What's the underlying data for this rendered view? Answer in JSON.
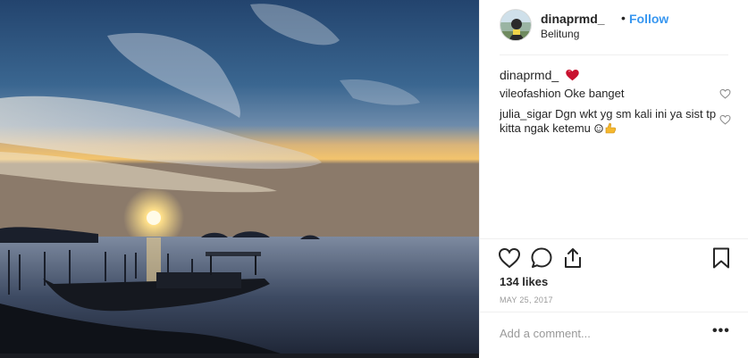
{
  "post": {
    "photo_icon": "sunset-photo",
    "author": {
      "username": "dinaprmd_",
      "separator": "•",
      "follow_label": "Follow",
      "location": "Belitung",
      "avatar_icon": "avatar-photo"
    },
    "caption": {
      "username": "dinaprmd_",
      "emoji": "heart-emoji"
    },
    "comments": [
      {
        "username": "vileofashion",
        "text": "Oke banget"
      },
      {
        "username": "julia_sigar",
        "text": "Dgn wkt yg sm kali ini ya sist tp kitta ngak ketemu"
      }
    ],
    "likes_label": "134 likes",
    "date_label": "MAY 25, 2017",
    "add_comment_placeholder": "Add a comment...",
    "more_label": "•••"
  },
  "colors": {
    "accent": "#3897f0",
    "text": "#262626",
    "muted": "#999999",
    "heart": "#ed4956"
  }
}
